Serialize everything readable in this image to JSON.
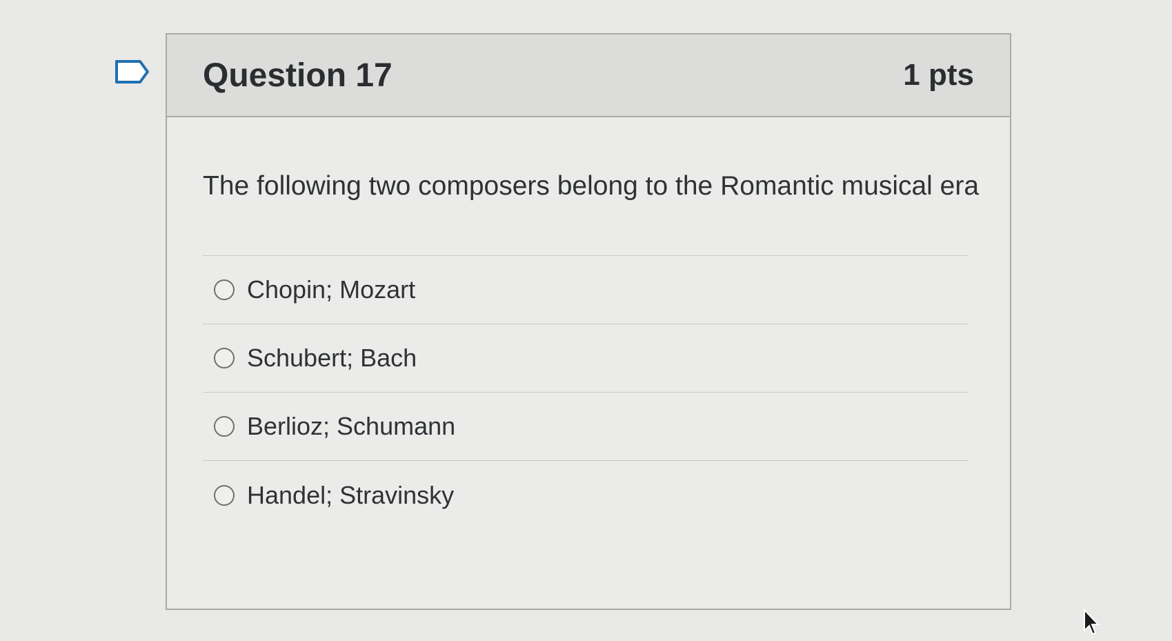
{
  "question": {
    "title": "Question 17",
    "points": "1 pts",
    "text": "The following two composers belong to the Romantic musical era"
  },
  "answers": [
    {
      "label": "Chopin; Mozart"
    },
    {
      "label": "Schubert; Bach"
    },
    {
      "label": "Berlioz; Schumann"
    },
    {
      "label": "Handel; Stravinsky"
    }
  ],
  "icons": {
    "flag": "flag-icon",
    "radio": "radio-button-icon",
    "cursor": "mouse-cursor-icon"
  }
}
